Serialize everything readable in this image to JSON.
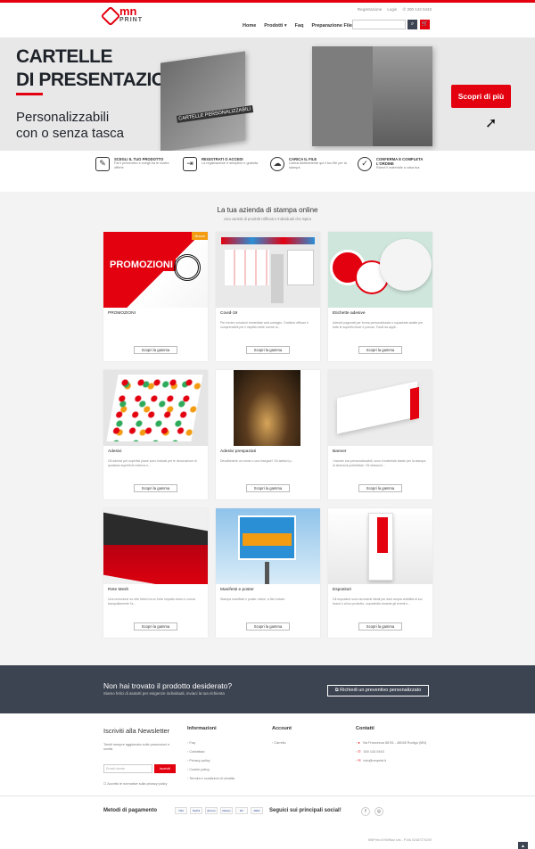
{
  "header": {
    "logo_main": "mn",
    "logo_sub": "PRINT",
    "register": "Registrazione",
    "login": "Login",
    "phone": "300 143 0443",
    "nav": [
      "Home",
      "Prodotti ▾",
      "Faq",
      "Preparazione File"
    ]
  },
  "banner": {
    "title_line1": "CARTELLE",
    "title_line2": "DI PRESENTAZIONE",
    "subtitle_line1": "Personalizzabili",
    "subtitle_line2": "con o senza tasca",
    "folder_label": "CARTELLE PERSONALIZZABILI",
    "cta": "Scopri di più"
  },
  "steps": [
    {
      "title": "SCEGLI IL TUO PRODOTTO",
      "desc": "Fai il preventivo e scegli tra le nostre offerte"
    },
    {
      "title": "REGISTRATI O ACCEDI",
      "desc": "La registrazione è semplice e gratuita"
    },
    {
      "title": "CARICA IL FILE",
      "desc": "Carica direttamente qui il tuo file per la stampa"
    },
    {
      "title": "CONFERMA E COMPLETA L'ORDINE",
      "desc": "Ricevi il materiale a casa tua"
    }
  ],
  "products": {
    "title": "La tua azienda di stampa online",
    "subtitle": "Una varietà di prodotti raffinati e individuali che ispira",
    "button_label": "Scopri la gamma",
    "items": [
      {
        "name": "PROMOZIONI",
        "desc": "",
        "badge": "Nuovo"
      },
      {
        "name": "Covid-19",
        "desc": "Per fornire soluzioni immediate anti-contagio. Grafiche efficaci e comprensibili per il rispetto delle norme di..."
      },
      {
        "name": "Etichette adesive",
        "desc": "Adesivi pagonati per forma personalizzata o squadrate adatte per tutte le superfici lisce e porose. Facili da appli..."
      },
      {
        "name": "Adesivi",
        "desc": "Gli adesivi per superfici piane sono indicati per le decorazione di qualsiasi superficie esterna e..."
      },
      {
        "name": "Adesivi prespaziati",
        "desc": "Decalbedere un nome o una insegna? Gli adesivi p..."
      },
      {
        "name": "Banner",
        "desc": "I banner son personalizzabili, sono il materiale ideale per la stampa di striscioni pubblicitari. Gli striscioni..."
      },
      {
        "name": "Rete Mesh",
        "desc": "Una recinzione su rete Mesh ha un forte impatto visivo e colora tranquillamente l'a..."
      },
      {
        "name": "Manifesti e poster",
        "desc": "Stampa manifesti e poster online, a fieri notare."
      },
      {
        "name": "Espositori",
        "desc": "Gli espositori sono strumenti ideali per dare ampia visibilità al tuo brand o al tuo prodotto, soprattutto durante gli eventi e..."
      }
    ]
  },
  "cta_band": {
    "title": "Non hai trovato il prodotto desiderato?",
    "subtitle": "Siamo felici di aiutarti per esigenze individuali, inviaci la tua richiesta",
    "button": "Richiedi un preventivo personalizzato"
  },
  "footer": {
    "newsletter_title": "Iscriviti alla Newsletter",
    "newsletter_desc": "Tieniti sempre aggiornato sulle promozioni e novità",
    "newsletter_placeholder": "Email utente",
    "newsletter_button": "Iscriviti",
    "newsletter_check": "Accetto le normative sulla privacy policy",
    "info_title": "Informazioni",
    "info_items": [
      "Faq",
      "Contattaci",
      "Privacy policy",
      "Cookie policy",
      "Termini e condizioni di vendita"
    ],
    "account_title": "Account",
    "account_items": [
      "Carrello"
    ],
    "contact_title": "Contatti",
    "contact_items": [
      "Via Francesca 58 B1 - 48048 Rodigo (MN)",
      "300 143 0443",
      "info@mnprint.it"
    ],
    "payment_title": "Metodi di pagamento",
    "payment_icons": [
      "VISA",
      "PayPal",
      "discover",
      "Maestro",
      "MC",
      "AMEX"
    ],
    "social_title": "Seguici sui principali social!",
    "copyright": "MNPrint di NNRaul srls - P.IVA 02487270209"
  }
}
